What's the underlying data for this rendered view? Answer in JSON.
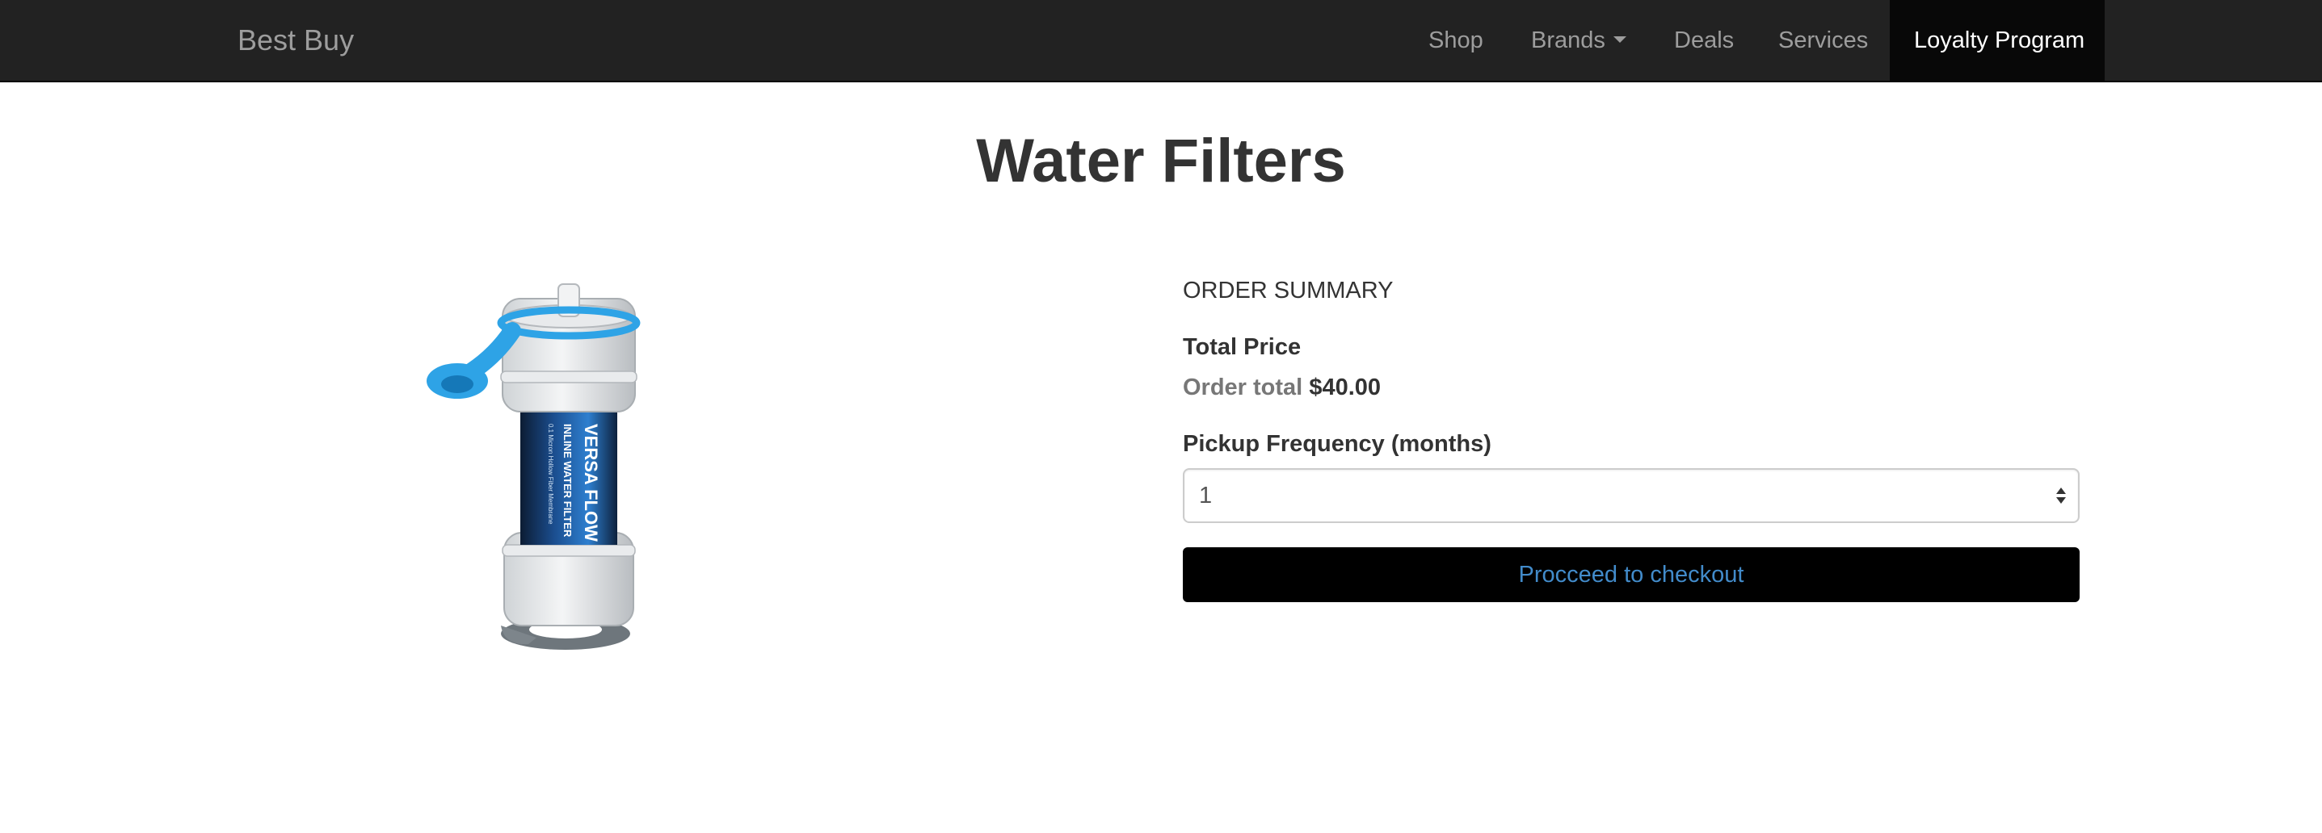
{
  "navbar": {
    "brand": "Best Buy",
    "items": [
      {
        "label": "Shop"
      },
      {
        "label": "Brands"
      },
      {
        "label": "Deals"
      },
      {
        "label": "Services"
      },
      {
        "label": "Loyalty Program"
      }
    ],
    "active_item": "Loyalty Program"
  },
  "page": {
    "title": "Water Filters"
  },
  "product": {
    "image_text": [
      "VERSA FLOW",
      "INLINE WATER FILTER",
      "0.1 Micron Hollow Fiber Membrane"
    ]
  },
  "summary": {
    "heading": "ORDER SUMMARY",
    "total_price_label": "Total Price",
    "order_total_label": "Order total",
    "order_total_value": "$40.00",
    "frequency_label": "Pickup Frequency (months)",
    "frequency_value": "1",
    "checkout_label": "Procceed to checkout"
  },
  "colors": {
    "navbar_bg": "#222222",
    "nav_active_bg": "#080808",
    "nav_text": "#9d9d9d",
    "checkout_bg": "#000000",
    "checkout_text": "#428bca",
    "filter_accent": "#2ea3e6"
  }
}
